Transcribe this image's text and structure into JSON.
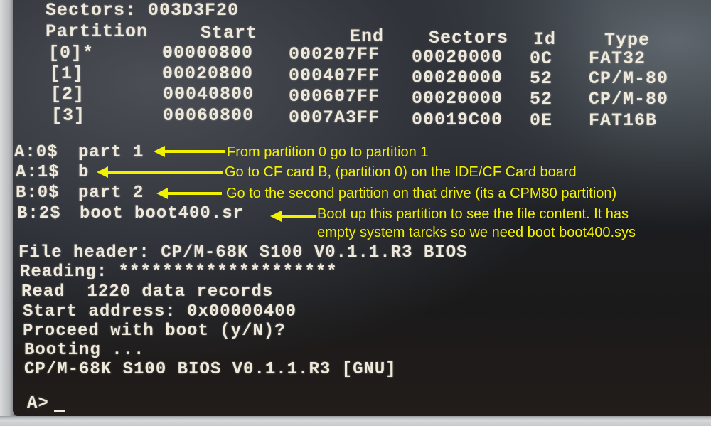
{
  "terminal": {
    "sectors_line": "Sectors: 003D3F20",
    "table": {
      "headers": [
        "Partition",
        "Start",
        "End",
        "Sectors",
        "Id",
        "Type"
      ],
      "rows": [
        {
          "partition": "[0]*",
          "start": "00000800",
          "end": "000207FF",
          "sectors": "00020000",
          "id": "0C",
          "type": "FAT32"
        },
        {
          "partition": "[1]",
          "start": "00020800",
          "end": "000407FF",
          "sectors": "00020000",
          "id": "52",
          "type": "CP/M-80"
        },
        {
          "partition": "[2]",
          "start": "00040800",
          "end": "000607FF",
          "sectors": "00020000",
          "id": "52",
          "type": "CP/M-80"
        },
        {
          "partition": "[3]",
          "start": "00060800",
          "end": "0007A3FF",
          "sectors": "00019C00",
          "id": "0E",
          "type": "FAT16B"
        }
      ]
    },
    "commands": [
      {
        "prompt": "A:0$",
        "command": "part 1"
      },
      {
        "prompt": "A:1$",
        "command": "b"
      },
      {
        "prompt": "B:0$",
        "command": "part 2"
      },
      {
        "prompt": "B:2$",
        "command": "boot boot400.sr"
      }
    ],
    "output_lines": [
      "File header: CP/M-68K S100 V0.1.1.R3 BIOS",
      "Reading: ********************",
      "Read  1220 data records",
      "Start address: 0x00000400",
      "Proceed with boot (y/N)?",
      "Booting ...",
      "CP/M-68K S100 BIOS V0.1.1.R3 [GNU]"
    ],
    "final_prompt": "A>"
  },
  "annotations": [
    "From partition 0 go to partition 1",
    "Go to CF card B, (partition 0) on the IDE/CF Card board",
    "Go to the second partition on that drive (its a CPM80 partition)",
    "Boot up this partition to see the file content. It has",
    "empty system tarcks so we need boot boot400.sys"
  ],
  "colors": {
    "annotation": "#f2f200",
    "terminal_text": "#efe9dc",
    "screen_bg": "#1c1e22"
  }
}
